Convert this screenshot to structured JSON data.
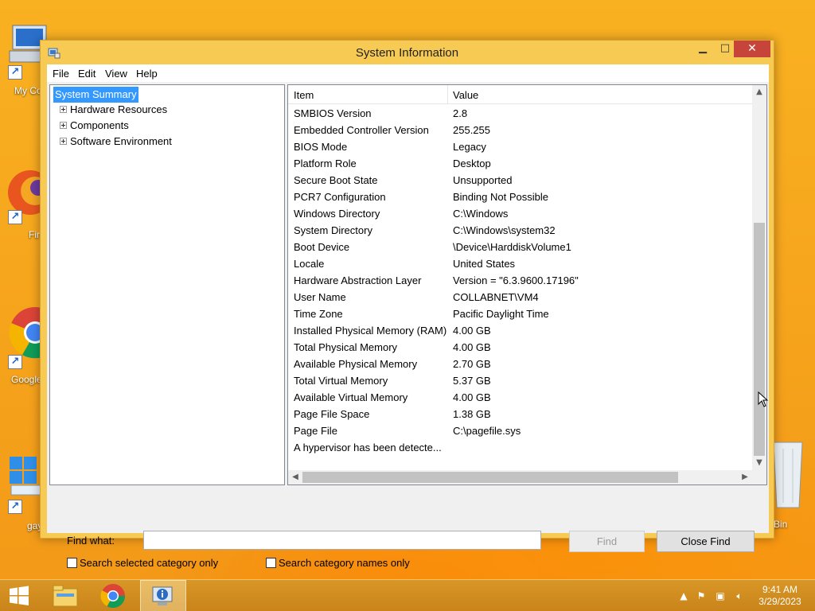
{
  "desktop": {
    "icons": [
      {
        "label": "My Co",
        "icon": "computer-icon"
      },
      {
        "label": "Fir",
        "icon": "firefox-icon"
      },
      {
        "label": "Google",
        "icon": "chrome-icon"
      },
      {
        "label": "gay",
        "icon": "windows-store-icon"
      },
      {
        "label": "Bin",
        "icon": "recycle-bin-icon"
      }
    ]
  },
  "window": {
    "title": "System Information",
    "menu": [
      "File",
      "Edit",
      "View",
      "Help"
    ],
    "tree": {
      "selected": "System Summary",
      "items": [
        "Hardware Resources",
        "Components",
        "Software Environment"
      ]
    },
    "list": {
      "columns": [
        "Item",
        "Value"
      ],
      "rows": [
        [
          "SMBIOS Version",
          "2.8"
        ],
        [
          "Embedded Controller Version",
          "255.255"
        ],
        [
          "BIOS Mode",
          "Legacy"
        ],
        [
          "Platform Role",
          "Desktop"
        ],
        [
          "Secure Boot State",
          "Unsupported"
        ],
        [
          "PCR7 Configuration",
          "Binding Not Possible"
        ],
        [
          "Windows Directory",
          "C:\\Windows"
        ],
        [
          "System Directory",
          "C:\\Windows\\system32"
        ],
        [
          "Boot Device",
          "\\Device\\HarddiskVolume1"
        ],
        [
          "Locale",
          "United States"
        ],
        [
          "Hardware Abstraction Layer",
          "Version = \"6.3.9600.17196\""
        ],
        [
          "User Name",
          "COLLABNET\\VM4"
        ],
        [
          "Time Zone",
          "Pacific Daylight Time"
        ],
        [
          "Installed Physical Memory (RAM)",
          "4.00 GB"
        ],
        [
          "Total Physical Memory",
          "4.00 GB"
        ],
        [
          "Available Physical Memory",
          "2.70 GB"
        ],
        [
          "Total Virtual Memory",
          "5.37 GB"
        ],
        [
          "Available Virtual Memory",
          "4.00 GB"
        ],
        [
          "Page File Space",
          "1.38 GB"
        ],
        [
          "Page File",
          "C:\\pagefile.sys"
        ],
        [
          "A hypervisor has been detecte...",
          ""
        ]
      ]
    },
    "find": {
      "label": "Find what:",
      "value": "",
      "find_button": "Find",
      "close_find_button": "Close Find",
      "check_selected_category": "Search selected category only",
      "check_category_names": "Search category names only"
    }
  },
  "taskbar": {
    "items": [
      "start-button",
      "file-explorer",
      "chrome",
      "system-information"
    ],
    "time": "9:41 AM",
    "date": "3/29/2023"
  },
  "colors": {
    "desktop_bg": "#f6a21c",
    "window_frame": "#f7ca54",
    "selection": "#3399ff",
    "close_button": "#c7443b"
  }
}
